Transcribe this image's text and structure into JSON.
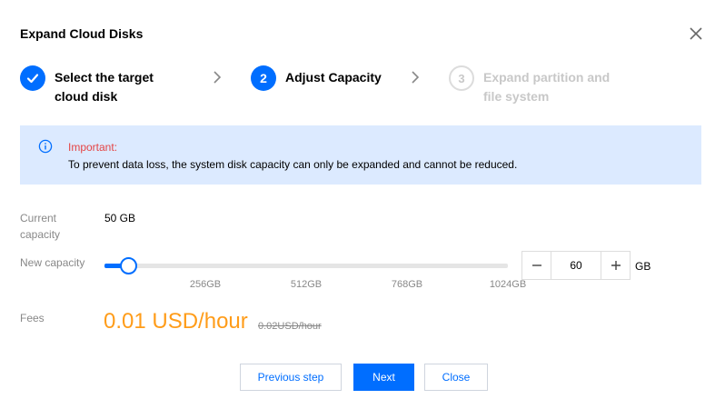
{
  "dialog": {
    "title": "Expand Cloud Disks",
    "close_icon": "close-icon"
  },
  "steps": [
    {
      "number": "1",
      "line1": "Select the target",
      "line2": "cloud disk",
      "state": "done",
      "icon": "check-icon"
    },
    {
      "number": "2",
      "line1": "Adjust Capacity",
      "line2": "",
      "state": "active"
    },
    {
      "number": "3",
      "line1": "Expand partition and",
      "line2": "file system",
      "state": "todo"
    }
  ],
  "notice": {
    "icon": "info-icon",
    "title": "Important:",
    "text": "To prevent data loss, the system disk capacity can only be expanded and cannot be reduced."
  },
  "form": {
    "current_capacity_label_1": "Current",
    "current_capacity_label_2": "capacity",
    "current_capacity_value": "50 GB",
    "new_capacity_label": "New capacity",
    "slider": {
      "value": 60,
      "min": 0,
      "max": 1024,
      "ticks": [
        "256GB",
        "512GB",
        "768GB",
        "1024GB"
      ]
    },
    "stepper_value": "60",
    "unit": "GB",
    "fees_label": "Fees",
    "fee_price": "0.01 USD/hour",
    "fee_original": "0.02USD/hour"
  },
  "buttons": {
    "previous": "Previous step",
    "next": "Next",
    "close": "Close"
  },
  "colors": {
    "primary": "#006eff",
    "warning_text": "#e54545",
    "notice_bg": "#dceaff",
    "price": "#ff9c19"
  }
}
